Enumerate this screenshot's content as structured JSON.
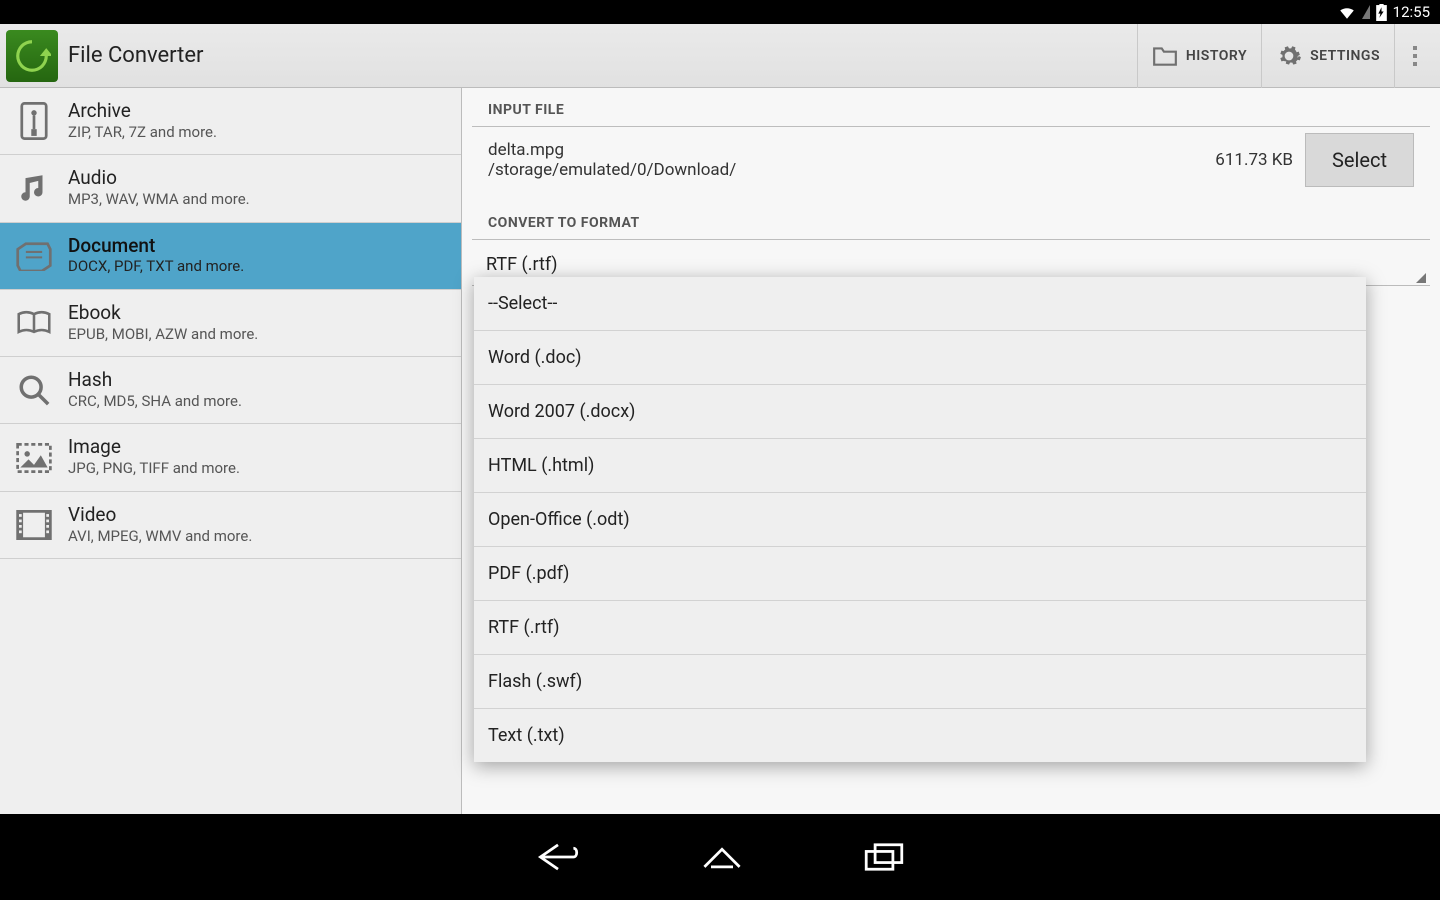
{
  "status": {
    "time": "12:55"
  },
  "app": {
    "title": "File Converter",
    "actions": {
      "history": "HISTORY",
      "settings": "SETTINGS"
    }
  },
  "sidebar": {
    "items": [
      {
        "title": "Archive",
        "sub": "ZIP, TAR, 7Z and more."
      },
      {
        "title": "Audio",
        "sub": "MP3, WAV, WMA and more."
      },
      {
        "title": "Document",
        "sub": "DOCX, PDF, TXT and more."
      },
      {
        "title": "Ebook",
        "sub": "EPUB, MOBI, AZW and more."
      },
      {
        "title": "Hash",
        "sub": "CRC, MD5, SHA and more."
      },
      {
        "title": "Image",
        "sub": "JPG, PNG, TIFF and more."
      },
      {
        "title": "Video",
        "sub": "AVI, MPEG, WMV and more."
      }
    ],
    "selected_index": 2
  },
  "main": {
    "input_label": "INPUT FILE",
    "file_name": "delta.mpg",
    "file_path": "/storage/emulated/0/Download/",
    "file_size": "611.73 KB",
    "select_btn": "Select",
    "convert_label": "CONVERT TO FORMAT",
    "selected_format": "RTF (.rtf)"
  },
  "dropdown": {
    "options": [
      "--Select--",
      "Word (.doc)",
      "Word 2007 (.docx)",
      "HTML (.html)",
      "Open-Office (.odt)",
      "PDF (.pdf)",
      "RTF (.rtf)",
      "Flash (.swf)",
      "Text (.txt)"
    ]
  }
}
